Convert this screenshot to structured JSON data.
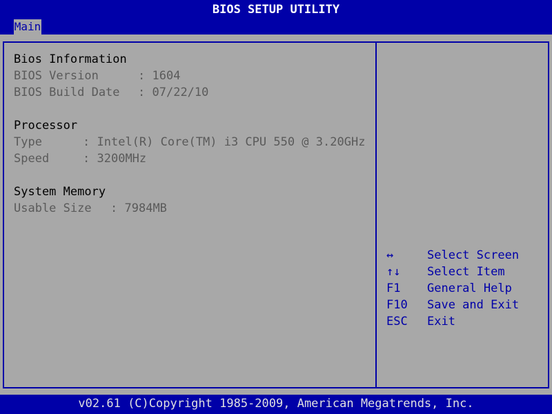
{
  "title": "BIOS SETUP UTILITY",
  "menu": {
    "tabs": [
      {
        "label": "Main",
        "active": true
      }
    ]
  },
  "bios_info": {
    "heading": "Bios Information",
    "rows": [
      {
        "label": "BIOS Version",
        "sep": ":",
        "value": "1604"
      },
      {
        "label": "BIOS Build Date",
        "sep": ":",
        "value": "07/22/10"
      }
    ]
  },
  "processor": {
    "heading": "Processor",
    "rows": [
      {
        "label": "Type",
        "sep": ":",
        "value": "Intel(R) Core(TM) i3 CPU 550 @ 3.20GHz"
      },
      {
        "label": "Speed",
        "sep": ":",
        "value": "3200MHz"
      }
    ]
  },
  "memory": {
    "heading": "System Memory",
    "rows": [
      {
        "label": "Usable Size",
        "sep": ":",
        "value": "7984MB"
      }
    ]
  },
  "help": [
    {
      "key": "↔",
      "action": "Select Screen",
      "icon": "left-right-arrow-icon"
    },
    {
      "key": "↑↓",
      "action": "Select Item",
      "icon": "up-down-arrow-icon"
    },
    {
      "key": "F1",
      "action": "General Help"
    },
    {
      "key": "F10",
      "action": "Save and Exit"
    },
    {
      "key": "ESC",
      "action": "Exit"
    }
  ],
  "footer": "v02.61 (C)Copyright 1985-2009, American Megatrends, Inc.",
  "colors": {
    "blue": "#0000a8",
    "panel": "#a8a8a8",
    "dim_text": "#5a5a5a"
  }
}
